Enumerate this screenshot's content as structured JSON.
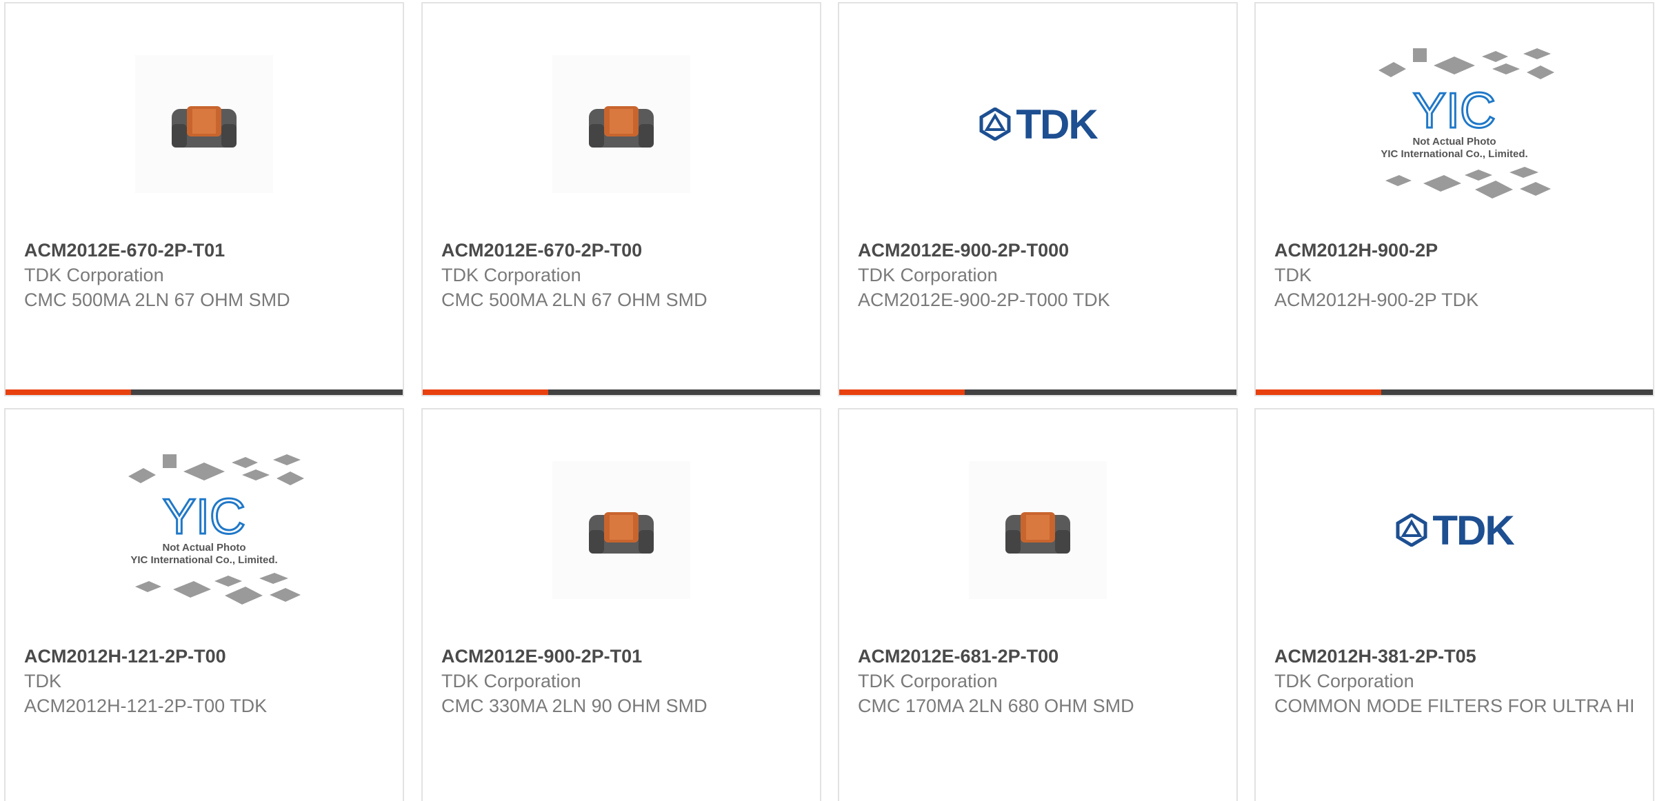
{
  "colors": {
    "accent": "#e8410f",
    "bar": "#424242",
    "title": "#4a4a4a",
    "text": "#7a7a7a",
    "tdk_blue": "#1d4f91",
    "yic_blue": "#1f78c8"
  },
  "products": [
    {
      "part_number": "ACM2012E-670-2P-T01",
      "manufacturer": "TDK Corporation",
      "description": "CMC 500MA 2LN 67 OHM SMD",
      "image": "inductor-photo"
    },
    {
      "part_number": "ACM2012E-670-2P-T00",
      "manufacturer": "TDK Corporation",
      "description": "CMC 500MA 2LN 67 OHM SMD",
      "image": "inductor-photo"
    },
    {
      "part_number": "ACM2012E-900-2P-T000",
      "manufacturer": "TDK Corporation",
      "description": "ACM2012E-900-2P-T000 TDK",
      "image": "tdk-logo"
    },
    {
      "part_number": "ACM2012H-900-2P",
      "manufacturer": "TDK",
      "description": "ACM2012H-900-2P TDK",
      "image": "yic-placeholder"
    },
    {
      "part_number": "ACM2012H-121-2P-T00",
      "manufacturer": "TDK",
      "description": "ACM2012H-121-2P-T00 TDK",
      "image": "yic-placeholder"
    },
    {
      "part_number": "ACM2012E-900-2P-T01",
      "manufacturer": "TDK Corporation",
      "description": "CMC 330MA 2LN 90 OHM SMD",
      "image": "inductor-photo"
    },
    {
      "part_number": "ACM2012E-681-2P-T00",
      "manufacturer": "TDK Corporation",
      "description": "CMC 170MA 2LN 680 OHM SMD",
      "image": "inductor-photo"
    },
    {
      "part_number": "ACM2012H-381-2P-T05",
      "manufacturer": "TDK Corporation",
      "description": "COMMON MODE FILTERS FOR ULTRA HI",
      "image": "tdk-logo"
    }
  ],
  "tdk_logo_text": "TDK",
  "yic_placeholder": {
    "logo": "YIC",
    "line1": "Not Actual Photo",
    "line2": "YIC International Co., Limited."
  }
}
